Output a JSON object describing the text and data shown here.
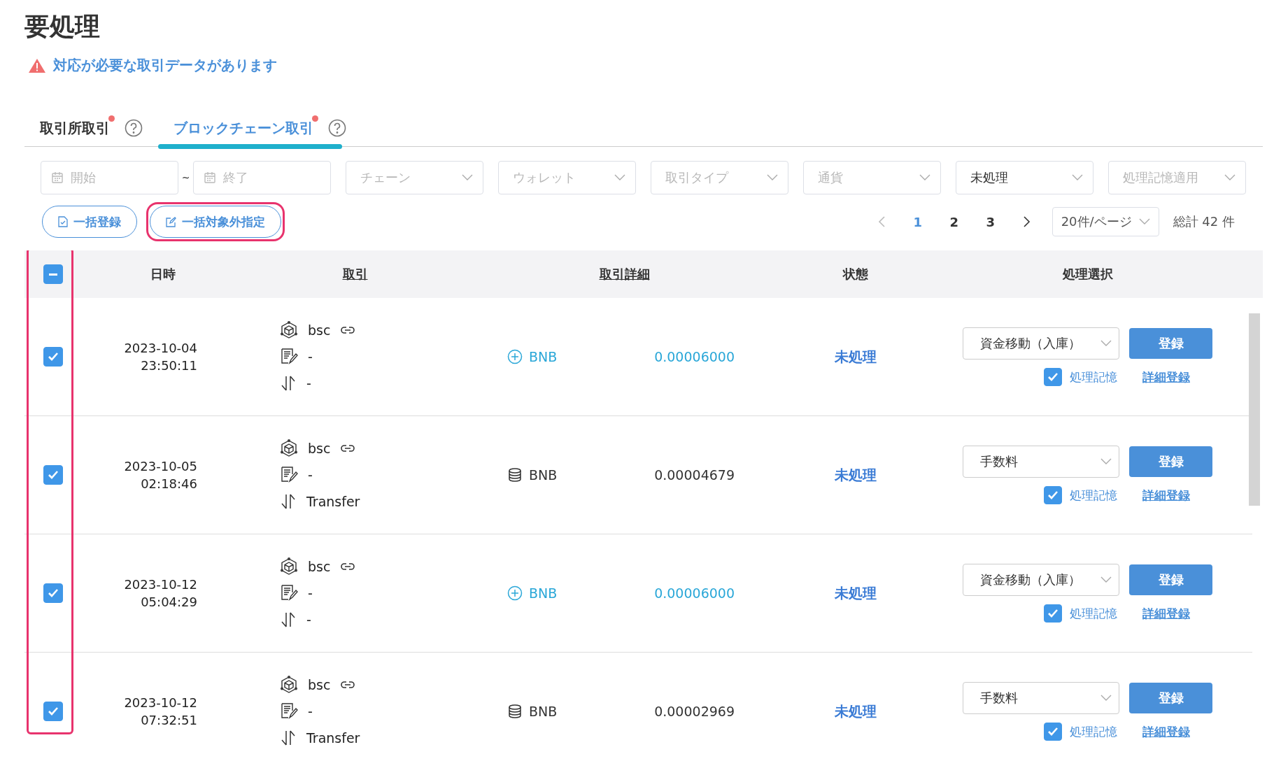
{
  "page": {
    "title": "要処理",
    "alert": "対応が必要な取引データがあります"
  },
  "tabs": [
    {
      "label": "取引所取引",
      "selected": false,
      "badge": true
    },
    {
      "label": "ブロックチェーン取引",
      "selected": true,
      "badge": true
    }
  ],
  "filters": {
    "date_start": {
      "placeholder": "開始"
    },
    "separator": "~",
    "date_end": {
      "placeholder": "終了"
    },
    "selects": [
      {
        "placeholder": "チェーン"
      },
      {
        "placeholder": "ウォレット"
      },
      {
        "placeholder": "取引タイプ"
      },
      {
        "placeholder": "通貨"
      },
      {
        "value": "未処理"
      },
      {
        "placeholder": "処理記憶適用"
      }
    ]
  },
  "actions": [
    {
      "kind": "register",
      "label": "一括登録",
      "highlighted": false
    },
    {
      "kind": "exclude",
      "label": "一括対象外指定",
      "highlighted": true
    }
  ],
  "pagination": {
    "pages": [
      {
        "label": "1",
        "selected": true
      },
      {
        "label": "2",
        "selected": false
      },
      {
        "label": "3",
        "selected": false
      }
    ],
    "page_size": "20件/ページ",
    "total": "総計 42 件"
  },
  "table": {
    "select_all": {
      "indeterminate": true
    },
    "checkbox_column_highlighted": true,
    "columns": [
      {
        "label": "日時",
        "sortable": false
      },
      {
        "label": "取引",
        "sortable": true
      },
      {
        "label": "取引詳細",
        "sortable": true
      },
      {
        "label": "状態",
        "sortable": false
      },
      {
        "label": "処理選択",
        "sortable": false
      }
    ],
    "rows": [
      {
        "checked": true,
        "date": "2023-10-04",
        "time": "23:50:11",
        "chain": "bsc",
        "memo": "-",
        "type": "-",
        "kind": "deposit",
        "currency": "BNB",
        "amount": "0.00006000",
        "status": "未処理",
        "category": "資金移動（入庫）",
        "register": "登録",
        "remember": {
          "label": "処理記憶",
          "checked": true
        },
        "detail_link": "詳細登録"
      },
      {
        "checked": true,
        "date": "2023-10-05",
        "time": "02:18:46",
        "chain": "bsc",
        "memo": "-",
        "type": "Transfer",
        "kind": "fee",
        "currency": "BNB",
        "amount": "0.00004679",
        "status": "未処理",
        "category": "手数料",
        "register": "登録",
        "remember": {
          "label": "処理記憶",
          "checked": true
        },
        "detail_link": "詳細登録"
      },
      {
        "checked": true,
        "date": "2023-10-12",
        "time": "05:04:29",
        "chain": "bsc",
        "memo": "-",
        "type": "-",
        "kind": "deposit",
        "currency": "BNB",
        "amount": "0.00006000",
        "status": "未処理",
        "category": "資金移動（入庫）",
        "register": "登録",
        "remember": {
          "label": "処理記憶",
          "checked": true
        },
        "detail_link": "詳細登録"
      },
      {
        "checked": true,
        "date": "2023-10-12",
        "time": "07:32:51",
        "chain": "bsc",
        "memo": "-",
        "type": "Transfer",
        "kind": "fee",
        "currency": "BNB",
        "amount": "0.00002969",
        "status": "未処理",
        "category": "手数料",
        "register": "登録",
        "remember": {
          "label": "処理記憶",
          "checked": true
        },
        "detail_link": "詳細登録"
      }
    ]
  }
}
